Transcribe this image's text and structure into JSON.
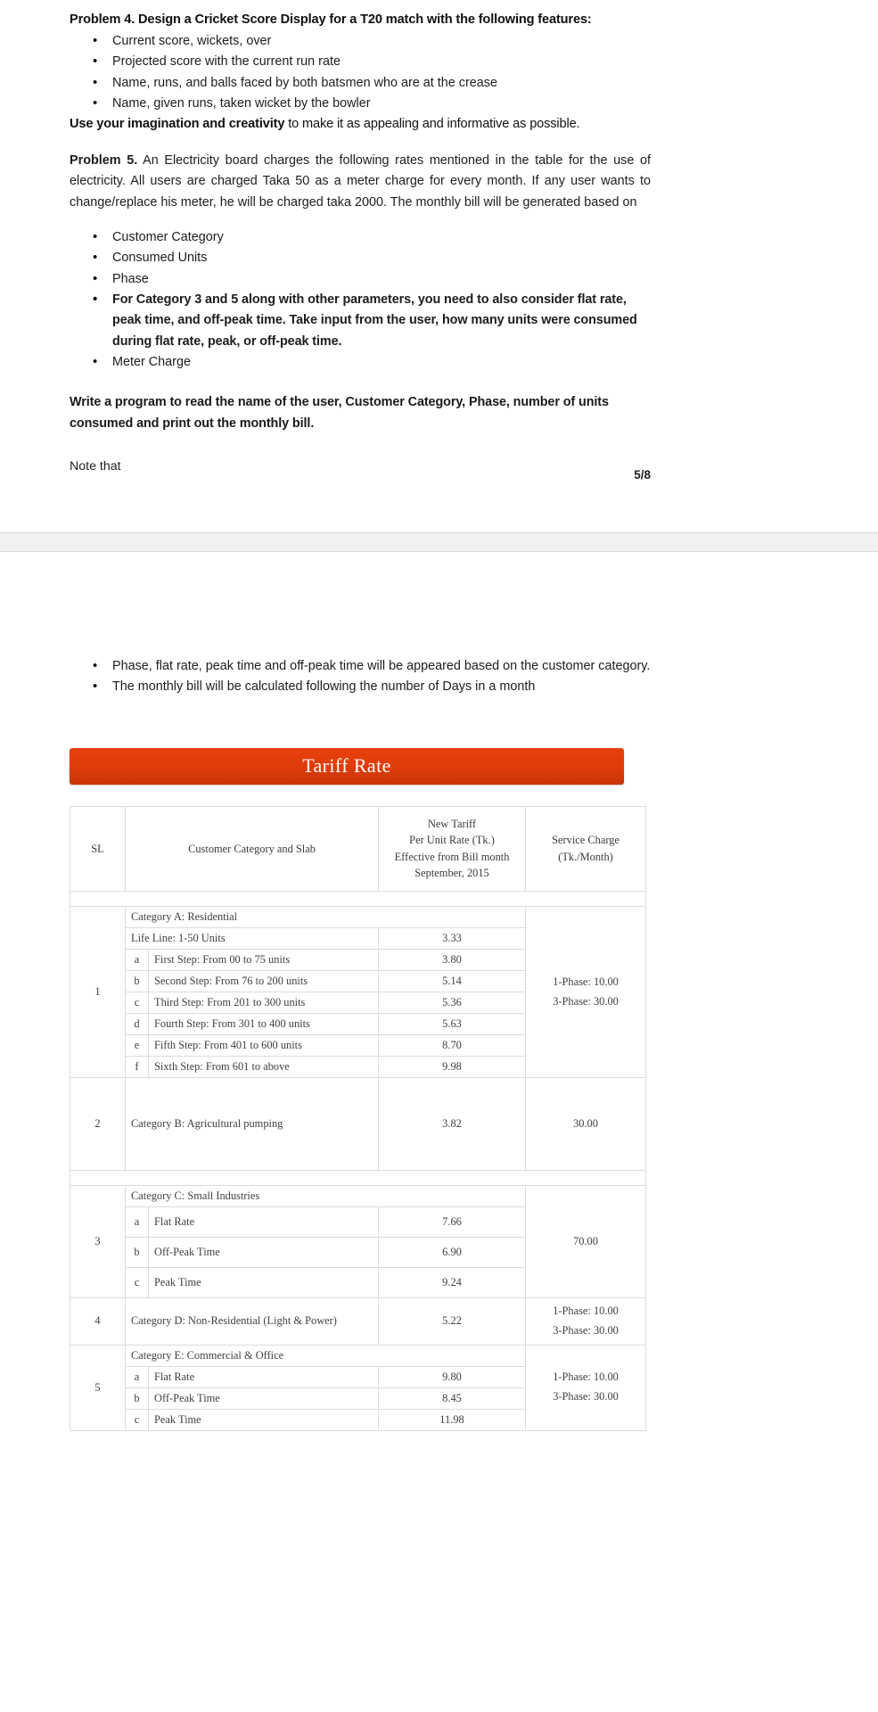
{
  "document": {
    "page_number": "5/8",
    "problem4": {
      "heading": "Problem 4. Design a Cricket Score Display for a T20 match with the following features:",
      "bullets": [
        "Current score, wickets, over",
        "Projected score with the current run rate",
        "Name, runs, and balls faced by both batsmen who are at the crease",
        "Name, given runs, taken wicket by the bowler"
      ],
      "closing_bold": "Use your imagination and creativity",
      "closing_rest": " to make it as appealing and informative as possible."
    },
    "problem5": {
      "label": "Problem 5.",
      "intro": " An Electricity board charges the following rates mentioned in the table for the use of electricity. All users are charged Taka 50 as a meter charge for every month. If any user wants to change/replace his meter, he will be charged taka 2000. The monthly bill will be generated based on",
      "bullets": [
        "Customer Category",
        "Consumed Units",
        "Phase",
        "For Category 3 and 5 along with other parameters, you need to also consider flat rate, peak time, and off-peak time. Take input from the user, how many units were consumed during flat rate, peak, or off-peak time.",
        "Meter Charge"
      ],
      "write_program": "Write a program to read the name of the user, Customer Category, Phase, number of units consumed and print out the monthly bill.",
      "note": "Note that",
      "note_bullets": [
        "Phase, flat rate, peak time and off-peak time will be appeared based on the customer category.",
        "The monthly bill will be calculated following the number of Days in a month"
      ]
    },
    "tariff": {
      "banner_title": "Tariff Rate",
      "headers": {
        "sl": "SL",
        "category": "Customer Category and Slab",
        "rate_l1": "New Tariff",
        "rate_l2": "Per Unit Rate (Tk.)",
        "rate_l3": "Effective from Bill month",
        "rate_l4": "September, 2015",
        "service_l1": "Service Charge",
        "service_l2": "(Tk./Month)"
      },
      "groups": [
        {
          "sl": "1",
          "title": "Category A: Residential",
          "lifeline_label": "Life Line: 1-50 Units",
          "lifeline_rate": "3.33",
          "service_l1": "1-Phase: 10.00",
          "service_l2": "3-Phase: 30.00",
          "rows": [
            {
              "letter": "a",
              "slab": "First Step: From 00 to 75 units",
              "rate": "3.80"
            },
            {
              "letter": "b",
              "slab": "Second Step: From 76 to 200 units",
              "rate": "5.14"
            },
            {
              "letter": "c",
              "slab": "Third Step: From 201 to 300 units",
              "rate": "5.36"
            },
            {
              "letter": "d",
              "slab": "Fourth Step: From 301 to 400 units",
              "rate": "5.63"
            },
            {
              "letter": "e",
              "slab": "Fifth Step: From 401 to 600 units",
              "rate": "8.70"
            },
            {
              "letter": "f",
              "slab": "Sixth Step: From 601 to above",
              "rate": "9.98"
            }
          ]
        },
        {
          "sl": "2",
          "title": "Category B: Agricultural pumping",
          "rate": "3.82",
          "service_l1": "30.00",
          "service_l2": ""
        },
        {
          "sl": "3",
          "title": "Category C: Small Industries",
          "service_l1": "70.00",
          "service_l2": "",
          "rows": [
            {
              "letter": "a",
              "slab": "Flat Rate",
              "rate": "7.66"
            },
            {
              "letter": "b",
              "slab": "Off-Peak Time",
              "rate": "6.90"
            },
            {
              "letter": "c",
              "slab": "Peak Time",
              "rate": "9.24"
            }
          ]
        },
        {
          "sl": "4",
          "title": "Category D: Non-Residential (Light & Power)",
          "rate": "5.22",
          "service_l1": "1-Phase: 10.00",
          "service_l2": "3-Phase: 30.00"
        },
        {
          "sl": "5",
          "title": "Category E: Commercial & Office",
          "service_l1": "1-Phase: 10.00",
          "service_l2": "3-Phase: 30.00",
          "rows": [
            {
              "letter": "a",
              "slab": "Flat Rate",
              "rate": "9.80"
            },
            {
              "letter": "b",
              "slab": "Off-Peak Time",
              "rate": "8.45"
            },
            {
              "letter": "c",
              "slab": "Peak Time",
              "rate": "11.98"
            }
          ]
        }
      ]
    }
  }
}
